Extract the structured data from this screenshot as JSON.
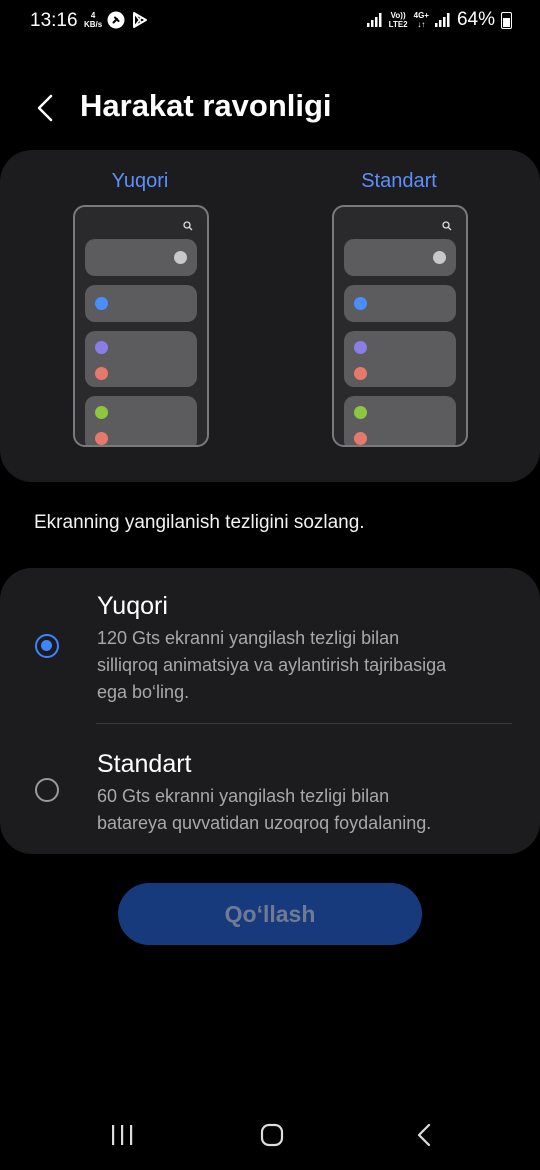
{
  "status_bar": {
    "time": "13:16",
    "speed_value": "4",
    "speed_unit": "KB/s",
    "volte": "Vo))",
    "lte": "LTE2",
    "network": "4G+",
    "battery": "64%"
  },
  "header": {
    "title": "Harakat ravonligi"
  },
  "preview": {
    "left_label": "Yuqori",
    "right_label": "Standart"
  },
  "description": "Ekranning yangilanish tezligini sozlang.",
  "options": [
    {
      "title": "Yuqori",
      "subtitle_lines": [
        "120 Gts ekranni yangilash tezligi bilan",
        "silliqroq animatsiya va aylantirish tajribasiga",
        "ega bo‘ling."
      ],
      "selected": true
    },
    {
      "title": "Standart",
      "subtitle_lines": [
        "60 Gts ekranni yangilash tezligi bilan",
        "batareya quvvatidan uzoqroq foydalaning."
      ],
      "selected": false
    }
  ],
  "apply_label": "Qo‘llash",
  "colors": {
    "accent": "#3f84ff",
    "label_blue": "#5b8fff",
    "card": "#1c1c1e",
    "button_bg": "#173a7d"
  }
}
